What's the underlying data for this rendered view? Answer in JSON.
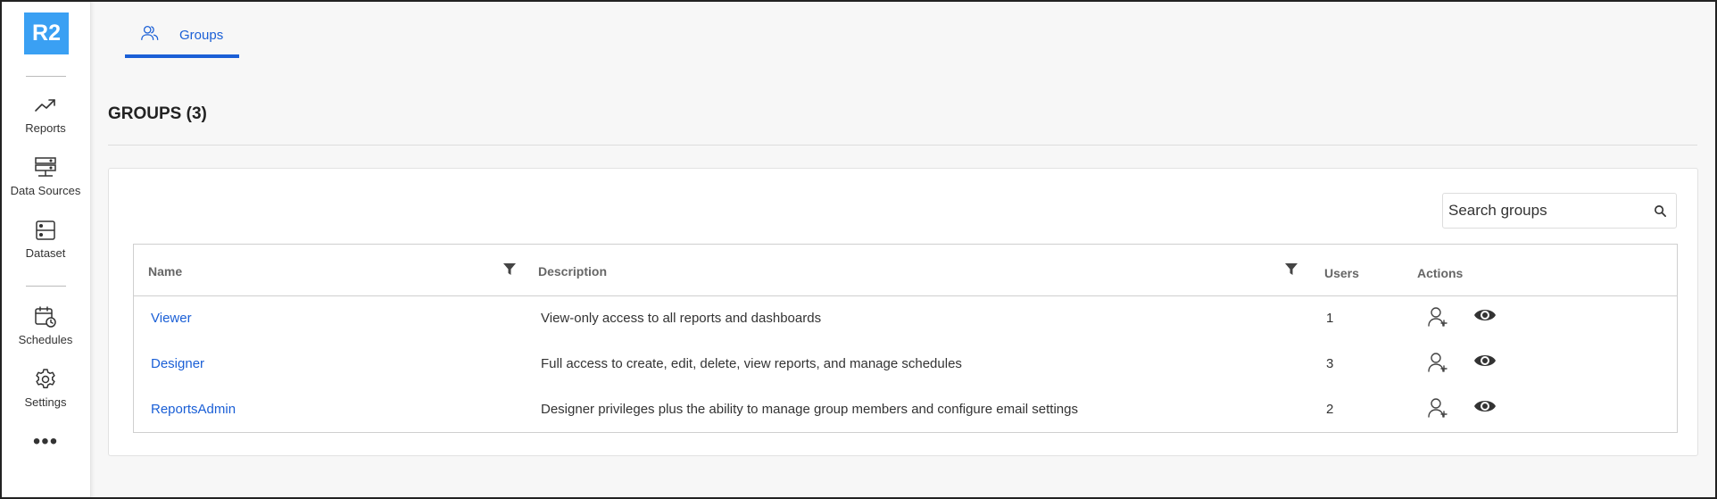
{
  "logo": {
    "text": "R2",
    "color": "#3aa0f3"
  },
  "sidebar": {
    "items": [
      {
        "label": "Reports",
        "icon": "trending-up-icon"
      },
      {
        "label": "Data Sources",
        "icon": "server-icon"
      },
      {
        "label": "Dataset",
        "icon": "dataset-icon"
      },
      {
        "label": "Schedules",
        "icon": "calendar-clock-icon"
      },
      {
        "label": "Settings",
        "icon": "gear-icon"
      }
    ],
    "more": "•••"
  },
  "tab": {
    "label": "Groups",
    "icon": "users-icon",
    "accent": "#1a5fd6"
  },
  "page": {
    "title": "GROUPS (3)"
  },
  "search": {
    "placeholder": "Search groups",
    "icon": "search-icon"
  },
  "table": {
    "headers": {
      "name": "Name",
      "description": "Description",
      "users": "Users",
      "actions": "Actions"
    },
    "rows": [
      {
        "name": "Viewer",
        "description": "View-only access to all reports and dashboards",
        "users": "1"
      },
      {
        "name": "Designer",
        "description": "Full access to create, edit, delete, view reports, and manage schedules",
        "users": "3"
      },
      {
        "name": "ReportsAdmin",
        "description": "Designer privileges plus the ability to manage group members and configure email settings",
        "users": "2"
      }
    ],
    "row_actions": [
      "add-user-icon",
      "eye-icon"
    ]
  }
}
